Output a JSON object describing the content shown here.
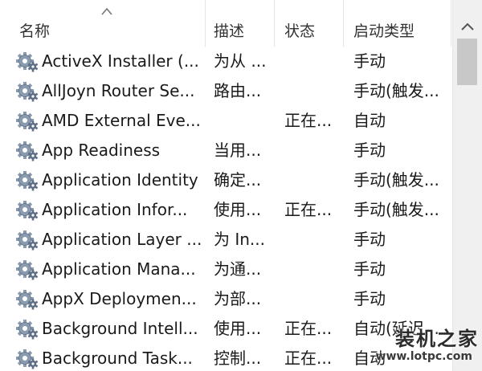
{
  "columns": {
    "name": "名称",
    "description": "描述",
    "status": "状态",
    "startup_type": "启动类型"
  },
  "sort": {
    "column": "name",
    "direction": "ascending"
  },
  "rows": [
    {
      "name": "ActiveX Installer (...",
      "description": "为从 ...",
      "status": "",
      "startup_type": "手动"
    },
    {
      "name": "AllJoyn Router Se...",
      "description": "路由...",
      "status": "",
      "startup_type": "手动(触发..."
    },
    {
      "name": "AMD External Eve...",
      "description": "",
      "status": "正在...",
      "startup_type": "自动"
    },
    {
      "name": "App Readiness",
      "description": "当用...",
      "status": "",
      "startup_type": "手动"
    },
    {
      "name": "Application Identity",
      "description": "确定...",
      "status": "",
      "startup_type": "手动(触发..."
    },
    {
      "name": "Application Infor...",
      "description": "使用...",
      "status": "正在...",
      "startup_type": "手动(触发..."
    },
    {
      "name": "Application Layer ...",
      "description": "为 In...",
      "status": "",
      "startup_type": "手动"
    },
    {
      "name": "Application Mana...",
      "description": "为通...",
      "status": "",
      "startup_type": "手动"
    },
    {
      "name": "AppX Deploymen...",
      "description": "为部...",
      "status": "",
      "startup_type": "手动"
    },
    {
      "name": "Background Intell...",
      "description": "使用...",
      "status": "正在...",
      "startup_type": "自动(延迟..."
    },
    {
      "name": "Background Task...",
      "description": "控制...",
      "status": "正在...",
      "startup_type": "自动"
    }
  ],
  "icons": {
    "service": "gear-icon",
    "sort": "sort-ascending-icon",
    "scroll_up": "chevron-up-icon"
  },
  "watermark": {
    "title": "装机之家",
    "url": "www.lotpc.com"
  },
  "colors": {
    "gear": "#8a9bb0",
    "gear_dark": "#5e6f85",
    "header_divider": "#e3e3e3",
    "scrollbar_track": "#f0f0f0",
    "scrollbar_thumb": "#c8c8c8"
  }
}
